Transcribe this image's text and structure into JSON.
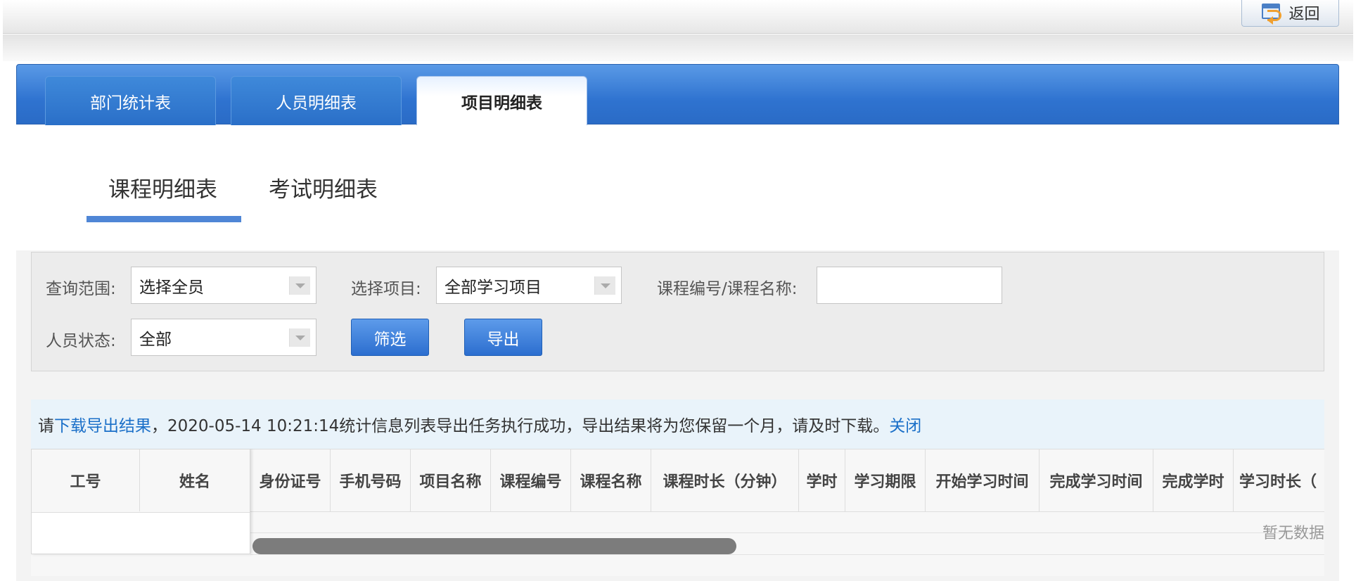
{
  "header": {
    "back_label": "返回"
  },
  "main_tabs": [
    {
      "label": "部门统计表",
      "active": false
    },
    {
      "label": "人员明细表",
      "active": false
    },
    {
      "label": "项目明细表",
      "active": true
    }
  ],
  "sub_tabs": [
    {
      "label": "课程明细表",
      "active": true
    },
    {
      "label": "考试明细表",
      "active": false
    }
  ],
  "filters": {
    "scope_label": "查询范围:",
    "scope_value": "选择全员",
    "project_label": "选择项目:",
    "project_value": "全部学习项目",
    "course_label": "课程编号/课程名称:",
    "course_value": "",
    "status_label": "人员状态:",
    "status_value": "全部",
    "filter_button": "筛选",
    "export_button": "导出"
  },
  "notice": {
    "prefix": "请",
    "download_link": "下载导出结果",
    "message": "，2020-05-14 10:21:14统计信息列表导出任务执行成功，导出结果将为您保留一个月，请及时下载。",
    "close_link": "关闭"
  },
  "table": {
    "fixed_columns": [
      "工号",
      "姓名"
    ],
    "columns": [
      "身份证号",
      "手机号码",
      "项目名称",
      "课程编号",
      "课程名称",
      "课程时长（分钟）",
      "学时",
      "学习期限",
      "开始学习时间",
      "完成学习时间",
      "完成学时",
      "学习时长（"
    ],
    "empty_text": "暂无数据"
  },
  "colors": {
    "accent": "#2f73d0",
    "link": "#1a6fc8",
    "underline": "#4f86d6"
  }
}
